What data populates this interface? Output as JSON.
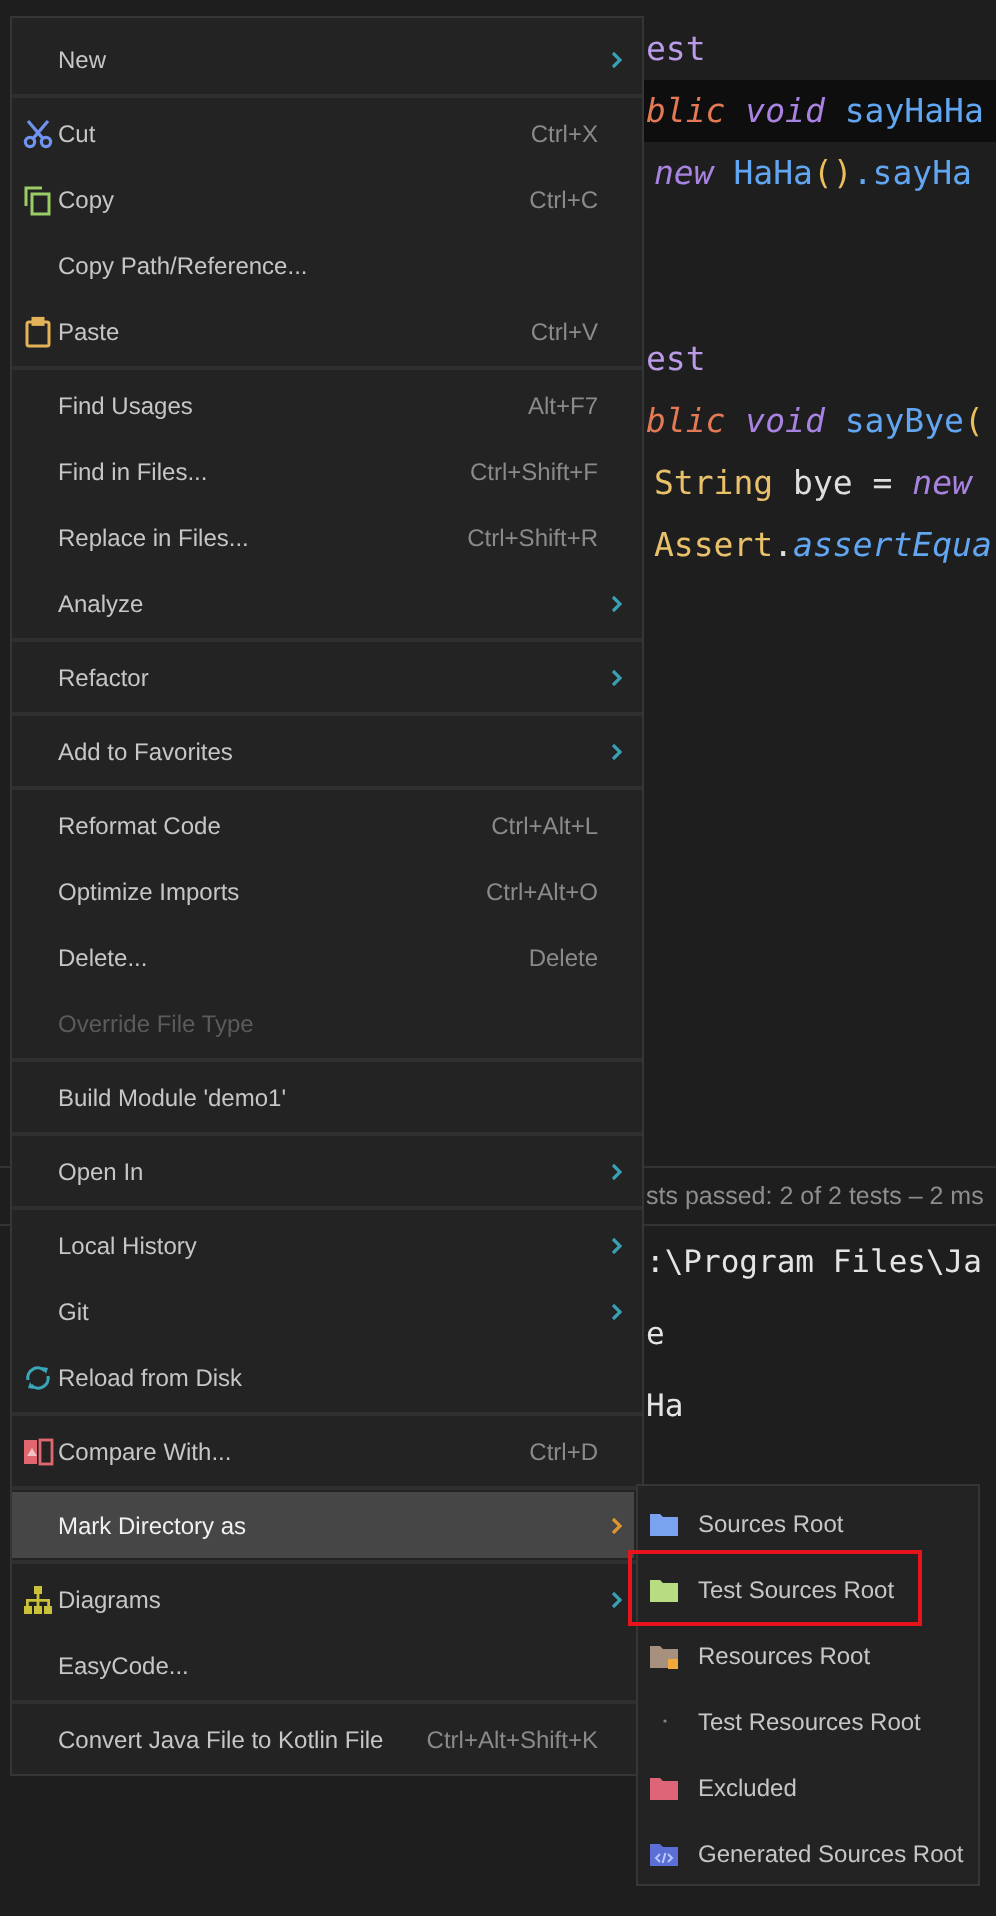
{
  "editor": {
    "code_blocks": [
      [
        {
          "current": false,
          "tokens": [
            {
              "text": "est",
              "kind": "annotation"
            }
          ]
        },
        {
          "current": true,
          "tokens": [
            {
              "text": "blic",
              "kind": "access"
            },
            {
              "text": " void",
              "kind": "keyword"
            },
            {
              "text": " sayHaHa",
              "kind": "method"
            }
          ]
        },
        {
          "current": false,
          "tokens": [
            {
              "text": "new",
              "kind": "keyword"
            },
            {
              "text": " HaHa",
              "kind": "method"
            },
            {
              "text": "()",
              "kind": "punct"
            },
            {
              "text": ".sayHa",
              "kind": "method"
            }
          ]
        }
      ],
      [
        {
          "current": false,
          "tokens": [
            {
              "text": "est",
              "kind": "annotation"
            }
          ]
        },
        {
          "current": false,
          "tokens": [
            {
              "text": "blic",
              "kind": "access"
            },
            {
              "text": " void",
              "kind": "keyword"
            },
            {
              "text": " sayBye",
              "kind": "method"
            },
            {
              "text": "(",
              "kind": "punct"
            }
          ]
        },
        {
          "current": false,
          "tokens": [
            {
              "text": "String",
              "kind": "type"
            },
            {
              "text": " bye = ",
              "kind": "plain"
            },
            {
              "text": "new",
              "kind": "keyword"
            }
          ]
        },
        {
          "current": false,
          "tokens": [
            {
              "text": "Assert",
              "kind": "type"
            },
            {
              "text": ".",
              "kind": "plain"
            },
            {
              "text": "assertEqua",
              "kind": "static"
            }
          ]
        }
      ]
    ]
  },
  "run_panel": {
    "status": "sts passed: 2 of 2 tests – 2 ms",
    "output": [
      ":\\Program Files\\Ja",
      "e",
      "Ha"
    ]
  },
  "context_menu": {
    "groups": [
      {
        "items": [
          {
            "label": "New",
            "submenu": true,
            "selected": false,
            "disabled": false
          }
        ]
      },
      {
        "items": [
          {
            "label": "Cut",
            "shortcut": "Ctrl+X",
            "submenu": false,
            "selected": false,
            "disabled": false
          },
          {
            "label": "Copy",
            "shortcut": "Ctrl+C",
            "submenu": false,
            "selected": false,
            "disabled": false
          },
          {
            "label": "Copy Path/Reference...",
            "submenu": false,
            "selected": false,
            "disabled": false
          },
          {
            "label": "Paste",
            "shortcut": "Ctrl+V",
            "submenu": false,
            "selected": false,
            "disabled": false
          }
        ]
      },
      {
        "items": [
          {
            "label": "Find Usages",
            "shortcut": "Alt+F7",
            "submenu": false,
            "selected": false,
            "disabled": false
          },
          {
            "label": "Find in Files...",
            "shortcut": "Ctrl+Shift+F",
            "submenu": false,
            "selected": false,
            "disabled": false
          },
          {
            "label": "Replace in Files...",
            "shortcut": "Ctrl+Shift+R",
            "submenu": false,
            "selected": false,
            "disabled": false
          },
          {
            "label": "Analyze",
            "submenu": true,
            "selected": false,
            "disabled": false
          }
        ]
      },
      {
        "items": [
          {
            "label": "Refactor",
            "submenu": true,
            "selected": false,
            "disabled": false
          }
        ]
      },
      {
        "items": [
          {
            "label": "Add to Favorites",
            "submenu": true,
            "selected": false,
            "disabled": false
          }
        ]
      },
      {
        "items": [
          {
            "label": "Reformat Code",
            "shortcut": "Ctrl+Alt+L",
            "submenu": false,
            "selected": false,
            "disabled": false
          },
          {
            "label": "Optimize Imports",
            "shortcut": "Ctrl+Alt+O",
            "submenu": false,
            "selected": false,
            "disabled": false
          },
          {
            "label": "Delete...",
            "shortcut": "Delete",
            "submenu": false,
            "selected": false,
            "disabled": false
          },
          {
            "label": "Override File Type",
            "submenu": false,
            "selected": false,
            "disabled": true
          }
        ]
      },
      {
        "items": [
          {
            "label": "Build Module 'demo1'",
            "submenu": false,
            "selected": false,
            "disabled": false
          }
        ]
      },
      {
        "items": [
          {
            "label": "Open In",
            "submenu": true,
            "selected": false,
            "disabled": false
          }
        ]
      },
      {
        "items": [
          {
            "label": "Local History",
            "submenu": true,
            "selected": false,
            "disabled": false
          },
          {
            "label": "Git",
            "submenu": true,
            "selected": false,
            "disabled": false
          },
          {
            "label": "Reload from Disk",
            "submenu": false,
            "selected": false,
            "disabled": false
          }
        ]
      },
      {
        "items": [
          {
            "label": "Compare With...",
            "shortcut": "Ctrl+D",
            "submenu": false,
            "selected": false,
            "disabled": false
          }
        ]
      },
      {
        "items": [
          {
            "label": "Mark Directory as",
            "submenu": true,
            "selected": true,
            "disabled": false
          }
        ]
      },
      {
        "items": [
          {
            "label": "Diagrams",
            "submenu": true,
            "selected": false,
            "disabled": false
          },
          {
            "label": "EasyCode...",
            "submenu": false,
            "selected": false,
            "disabled": false
          }
        ]
      },
      {
        "items": [
          {
            "label": "Convert Java File to Kotlin File",
            "shortcut": "Ctrl+Alt+Shift+K",
            "submenu": false,
            "selected": false,
            "disabled": false
          }
        ]
      }
    ]
  },
  "submenu": {
    "items": [
      {
        "label": "Sources Root",
        "annotated": false
      },
      {
        "label": "Test Sources Root",
        "annotated": true
      },
      {
        "label": "Resources Root",
        "annotated": false
      },
      {
        "label": "Test Resources Root",
        "annotated": false
      },
      {
        "label": "Excluded",
        "annotated": false
      },
      {
        "label": "Generated Sources Root",
        "annotated": false
      }
    ]
  }
}
